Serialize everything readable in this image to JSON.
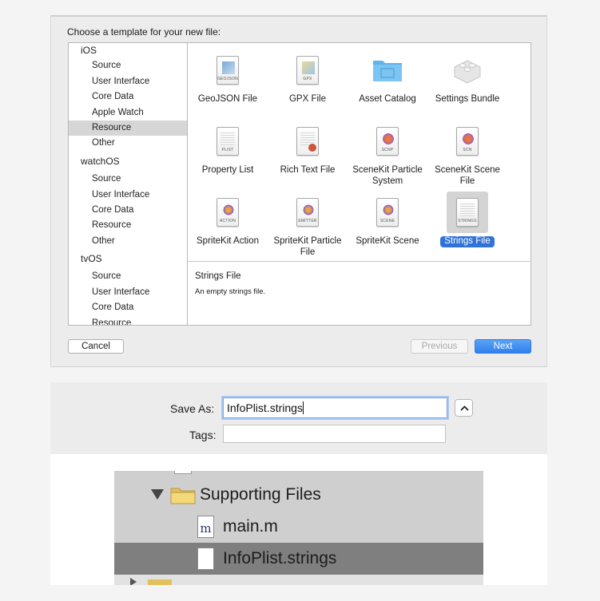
{
  "chooser": {
    "title": "Choose a template for your new file:",
    "categories": [
      {
        "group": "iOS",
        "items": [
          "Source",
          "User Interface",
          "Core Data",
          "Apple Watch",
          "Resource",
          "Other"
        ]
      },
      {
        "group": "watchOS",
        "items": [
          "Source",
          "User Interface",
          "Core Data",
          "Resource",
          "Other"
        ]
      },
      {
        "group": "tvOS",
        "items": [
          "Source",
          "User Interface",
          "Core Data",
          "Resource"
        ]
      }
    ],
    "selected_category": "iOS / Resource",
    "templates": [
      {
        "label": "GeoJSON File",
        "icon": "geojson-file-icon",
        "tag": "GEOJSON"
      },
      {
        "label": "GPX File",
        "icon": "gpx-file-icon",
        "tag": "GPX"
      },
      {
        "label": "Asset Catalog",
        "icon": "folder-icon",
        "tag": ""
      },
      {
        "label": "Settings Bundle",
        "icon": "lego-brick-icon",
        "tag": ""
      },
      {
        "label": "Property List",
        "icon": "plist-file-icon",
        "tag": "PLIST"
      },
      {
        "label": "Rich Text File",
        "icon": "rich-text-file-icon",
        "tag": ""
      },
      {
        "label": "SceneKit Particle System",
        "icon": "scnp-file-icon",
        "tag": "SCNP"
      },
      {
        "label": "SceneKit Scene File",
        "icon": "scn-file-icon",
        "tag": "SCN"
      },
      {
        "label": "SpriteKit Action",
        "icon": "action-file-icon",
        "tag": "ACTION"
      },
      {
        "label": "SpriteKit Particle File",
        "icon": "emitter-file-icon",
        "tag": "EMITTER"
      },
      {
        "label": "SpriteKit Scene",
        "icon": "scene-file-icon",
        "tag": "SCENE"
      },
      {
        "label": "Strings File",
        "icon": "strings-file-icon",
        "tag": "STRINGS"
      }
    ],
    "selected_template": "Strings File",
    "description_title": "Strings File",
    "description_text": "An empty strings file.",
    "cancel_label": "Cancel",
    "previous_label": "Previous",
    "next_label": "Next",
    "colors": {
      "accent": "#2f73d8",
      "next_button": "#3a87f0"
    }
  },
  "save": {
    "save_as_label": "Save As:",
    "save_as_value": "InfoPlist.strings",
    "tags_label": "Tags:",
    "tags_value": ""
  },
  "navigator": {
    "folder_label": "Supporting Files",
    "rows": [
      {
        "label": "main.m",
        "icon": "objc-m-file-icon",
        "icon_letter": "m"
      },
      {
        "label": "InfoPlist.strings",
        "icon": "strings-file-icon",
        "icon_letter": ""
      }
    ],
    "selected_row": "InfoPlist.strings"
  }
}
